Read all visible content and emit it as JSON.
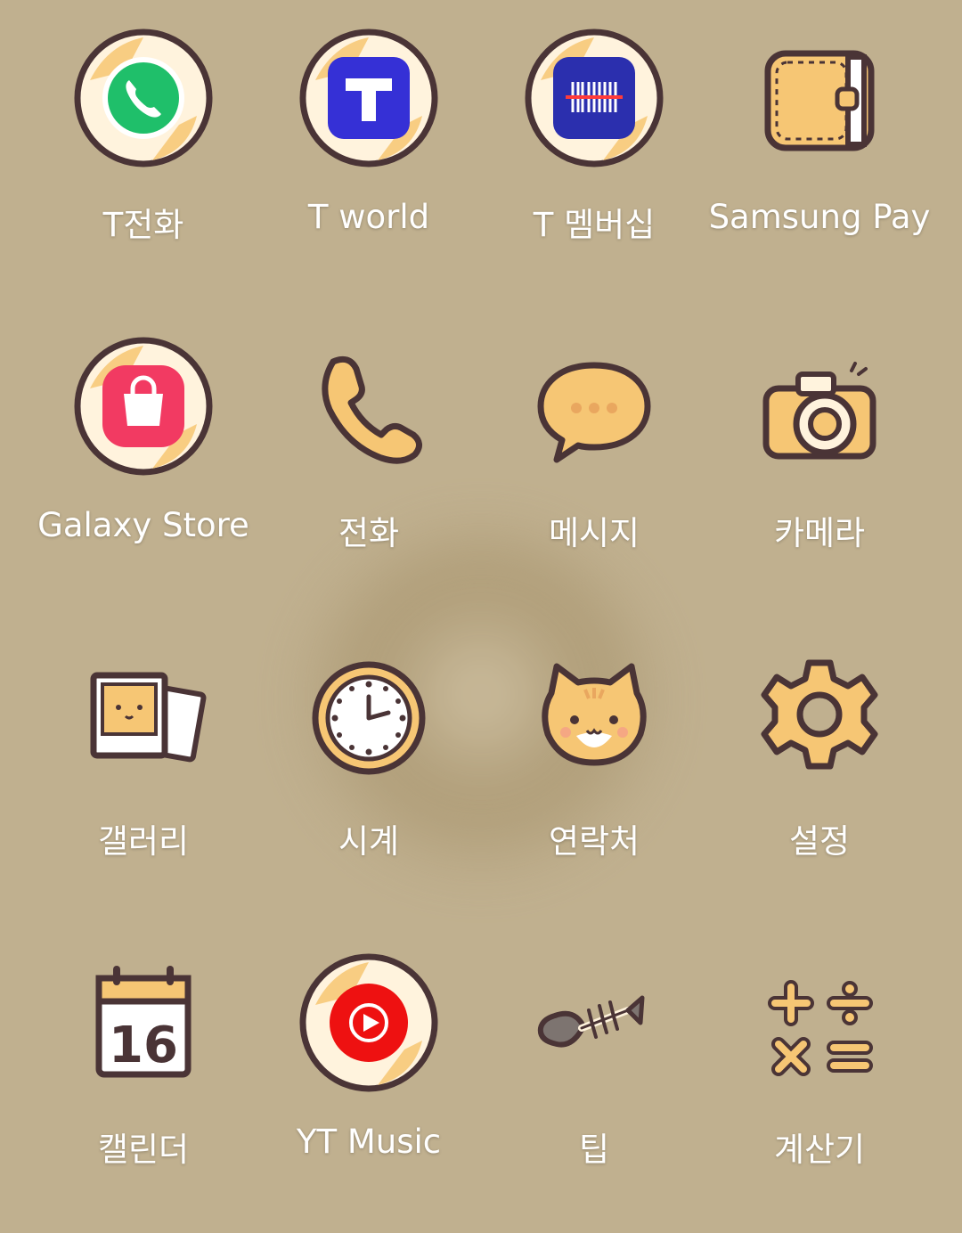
{
  "apps": [
    {
      "label": "T전화",
      "icon": "t-phone-icon"
    },
    {
      "label": "T world",
      "icon": "t-world-icon"
    },
    {
      "label": "T 멤버십",
      "icon": "barcode-icon"
    },
    {
      "label": "Samsung Pay",
      "icon": "wallet-icon"
    },
    {
      "label": "Galaxy Store",
      "icon": "shopping-bag-icon"
    },
    {
      "label": "전화",
      "icon": "phone-handset-icon"
    },
    {
      "label": "메시지",
      "icon": "speech-bubble-icon"
    },
    {
      "label": "카메라",
      "icon": "camera-icon"
    },
    {
      "label": "갤러리",
      "icon": "photos-icon"
    },
    {
      "label": "시계",
      "icon": "clock-icon"
    },
    {
      "label": "연락처",
      "icon": "cat-face-icon"
    },
    {
      "label": "설정",
      "icon": "gear-icon"
    },
    {
      "label": "캘린더",
      "icon": "calendar-icon",
      "day": "16"
    },
    {
      "label": "YT Music",
      "icon": "play-icon"
    },
    {
      "label": "팁",
      "icon": "fish-bone-icon"
    },
    {
      "label": "계산기",
      "icon": "calculator-icon"
    }
  ],
  "colors": {
    "background": "#c0b08f",
    "outline": "#4a3436",
    "cream": "#fff3dd",
    "accent": "#f6c674"
  }
}
